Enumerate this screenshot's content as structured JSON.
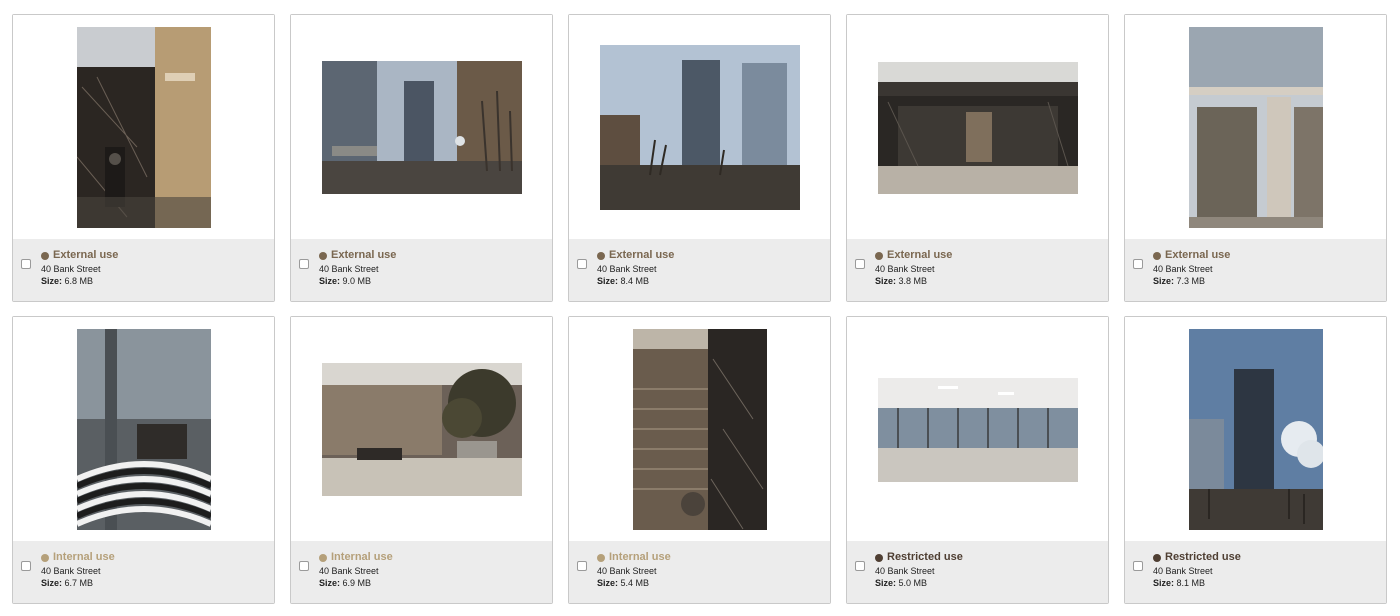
{
  "assets": [
    {
      "usage": "External use",
      "usage_class": "ext",
      "location": "40 Bank Street",
      "size_label": "Size:",
      "size_value": "6.8 MB",
      "thumbnail": "lobby-wall-entrance-image"
    },
    {
      "usage": "External use",
      "usage_class": "ext",
      "location": "40 Bank Street",
      "size_label": "Size:",
      "size_value": "9.0 MB",
      "thumbnail": "tower-plaza-image"
    },
    {
      "usage": "External use",
      "usage_class": "ext",
      "location": "40 Bank Street",
      "size_label": "Size:",
      "size_value": "8.4 MB",
      "thumbnail": "twin-towers-image"
    },
    {
      "usage": "External use",
      "usage_class": "ext",
      "location": "40 Bank Street",
      "size_label": "Size:",
      "size_value": "3.8 MB",
      "thumbnail": "lobby-elevators-image"
    },
    {
      "usage": "External use",
      "usage_class": "ext",
      "location": "40 Bank Street",
      "size_label": "Size:",
      "size_value": "7.3 MB",
      "thumbnail": "building-entrance-image"
    },
    {
      "usage": "Internal use",
      "usage_class": "int",
      "location": "40 Bank Street",
      "size_label": "Size:",
      "size_value": "6.7 MB",
      "thumbnail": "atrium-reception-image"
    },
    {
      "usage": "Internal use",
      "usage_class": "int",
      "location": "40 Bank Street",
      "size_label": "Size:",
      "size_value": "6.9 MB",
      "thumbnail": "lobby-interior-image"
    },
    {
      "usage": "Internal use",
      "usage_class": "int",
      "location": "40 Bank Street",
      "size_label": "Size:",
      "size_value": "5.4 MB",
      "thumbnail": "marble-column-image"
    },
    {
      "usage": "Restricted use",
      "usage_class": "res",
      "location": "40 Bank Street",
      "size_label": "Size:",
      "size_value": "5.0 MB",
      "thumbnail": "open-office-floor-image"
    },
    {
      "usage": "Restricted use",
      "usage_class": "res",
      "location": "40 Bank Street",
      "size_label": "Size:",
      "size_value": "8.1 MB",
      "thumbnail": "tower-skyline-image"
    }
  ],
  "colors": {
    "external_use": "#7a6750",
    "internal_use": "#b5a07a",
    "restricted_use": "#4f3f33",
    "meta_background": "#ececec",
    "card_border": "#c9c9c9"
  }
}
